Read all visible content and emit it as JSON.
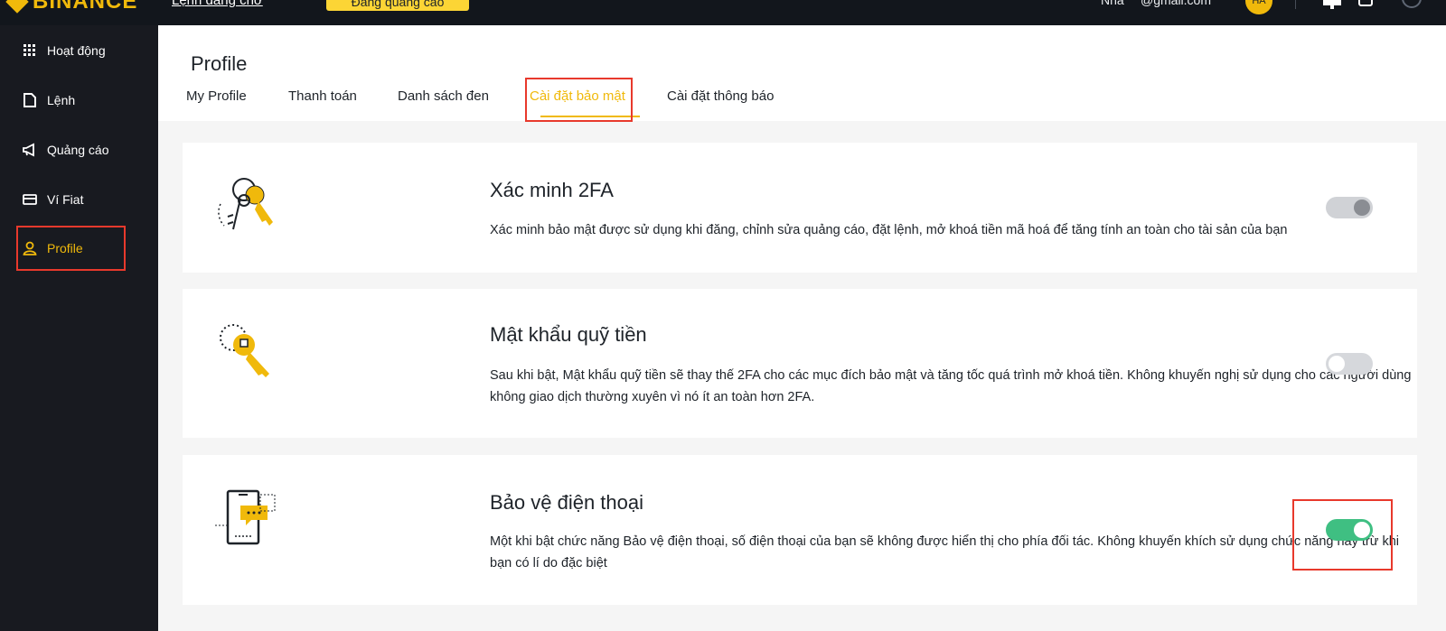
{
  "topbar": {
    "brand": "BINANCE",
    "link": "Lệnh đang chờ",
    "cta": "Đăng quảng cáo",
    "right_text_1": "Nhà",
    "right_text_2": "@gmail.com",
    "avatar": "HA"
  },
  "sidebar": {
    "items": [
      {
        "label": "Hoạt động",
        "icon": "grid-icon"
      },
      {
        "label": "Lệnh",
        "icon": "document-icon"
      },
      {
        "label": "Quảng cáo",
        "icon": "megaphone-icon"
      },
      {
        "label": "Ví Fiat",
        "icon": "wallet-icon"
      },
      {
        "label": "Profile",
        "icon": "user-icon"
      }
    ]
  },
  "main": {
    "title": "Profile",
    "tabs": [
      {
        "label": "My Profile"
      },
      {
        "label": "Thanh toán"
      },
      {
        "label": "Danh sách đen"
      },
      {
        "label": "Cài đặt bảo mật"
      },
      {
        "label": "Cài đặt thông báo"
      }
    ],
    "active_tab": "Cài đặt bảo mật"
  },
  "cards": [
    {
      "title": "Xác minh 2FA",
      "description": "Xác minh bảo mật được sử dụng khi đăng, chỉnh sửa quảng cáo, đặt lệnh, mở khoá tiền mã hoá để tăng tính an toàn cho tài sản của bạn",
      "toggle_state": "on-disabled",
      "illustration": "keys-illustration"
    },
    {
      "title": "Mật khẩu quỹ tiền",
      "description": "Sau khi bật, Mật khẩu quỹ tiền sẽ thay thế 2FA cho các mục đích bảo mật và tăng tốc quá trình mở khoá tiền. Không khuyến nghị sử dụng cho các người dùng không giao dịch thường xuyên vì nó ít an toàn hơn 2FA.",
      "toggle_state": "off",
      "illustration": "key-illustration"
    },
    {
      "title": "Bảo vệ điện thoại",
      "description": "Một khi bật chức năng Bảo vệ điện thoại, số điện thoại của bạn sẽ không được hiển thị cho phía đối tác. Không khuyến khích sử dụng chức năng này trừ khi bạn có lí do đặc biệt",
      "toggle_state": "on",
      "illustration": "phone-illustration"
    }
  ],
  "colors": {
    "accent": "#f0b90b",
    "toggle_on": "#3fbf82",
    "highlight_box": "#e8392c",
    "sidebar_bg": "#181a20"
  }
}
